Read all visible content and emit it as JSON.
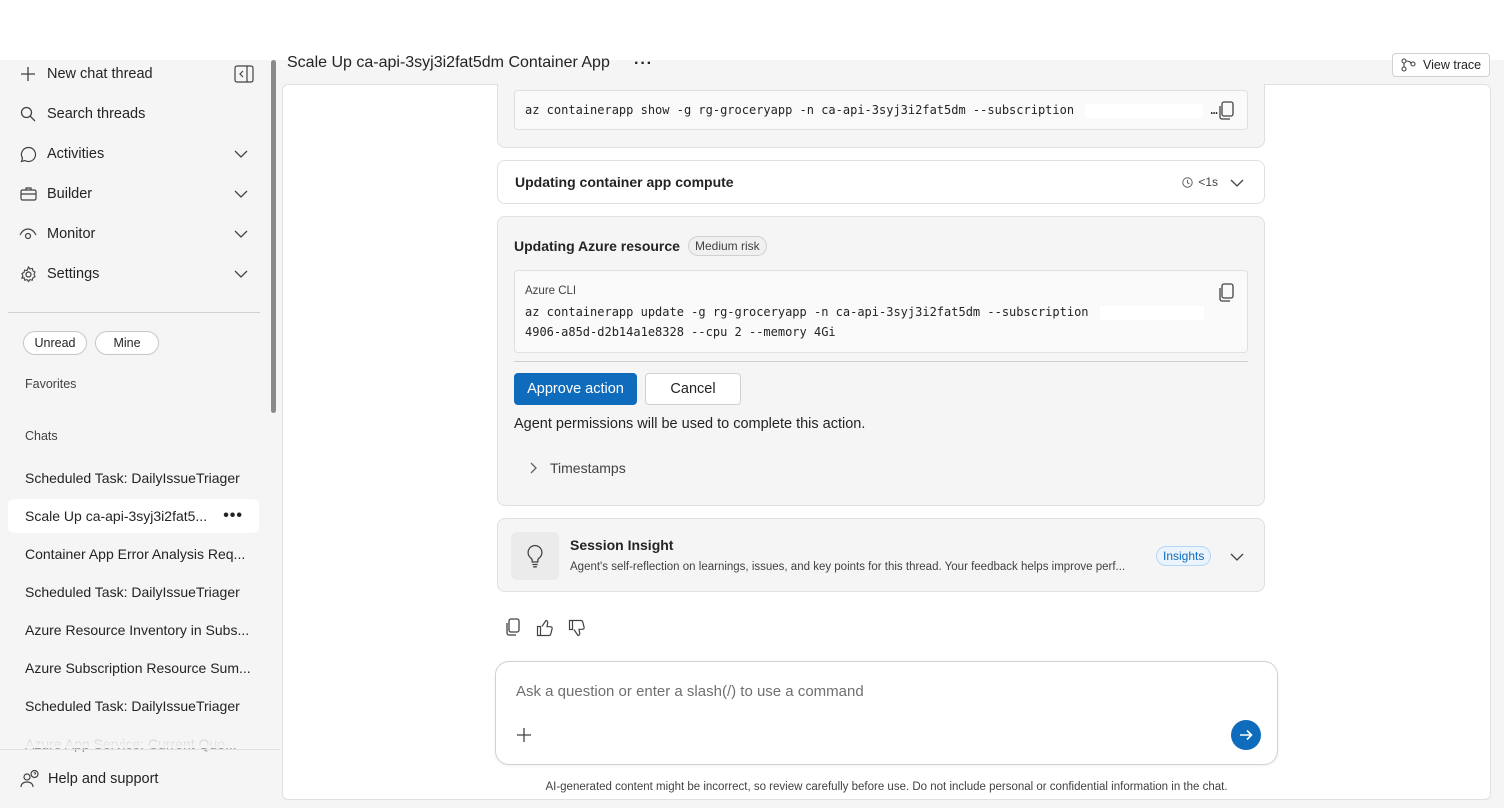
{
  "sidebar": {
    "nav": [
      {
        "label": "New chat thread",
        "icon": "plus-icon"
      },
      {
        "label": "Search threads",
        "icon": "search-icon"
      },
      {
        "label": "Activities",
        "icon": "chat-bubble-icon"
      },
      {
        "label": "Builder",
        "icon": "briefcase-icon"
      },
      {
        "label": "Monitor",
        "icon": "eye-icon"
      },
      {
        "label": "Settings",
        "icon": "gear-icon"
      }
    ],
    "filters": {
      "unread": "Unread",
      "mine": "Mine"
    },
    "favorites_label": "Favorites",
    "chats_label": "Chats",
    "chats": [
      "Scheduled Task: DailyIssueTriager",
      "Scale Up ca-api-3syj3i2fat5...",
      "Container App Error Analysis Req...",
      "Scheduled Task: DailyIssueTriager",
      "Azure Resource Inventory in Subs...",
      "Azure Subscription Resource Sum...",
      "Scheduled Task: DailyIssueTriager",
      "Azure App Service: Current Quo..."
    ],
    "active_chat_index": 1,
    "help": "Help and support"
  },
  "header": {
    "title": "Scale Up ca-api-3syj3i2fat5dm Container App",
    "more": "···",
    "view_trace": "View trace"
  },
  "thread": {
    "first_command": "az containerapp show -g rg-groceryapp -n ca-api-3syj3i2fat5dm --subscription",
    "first_command_tail": "…",
    "step": {
      "title": "Updating container app compute",
      "duration": "<1s"
    },
    "action": {
      "title": "Updating Azure resource",
      "risk": "Medium risk",
      "code_label": "Azure CLI",
      "code_line1": "az containerapp update -g rg-groceryapp -n ca-api-3syj3i2fat5dm --subscription",
      "code_line2": "4906-a85d-d2b14a1e8328 --cpu 2 --memory 4Gi",
      "approve": "Approve action",
      "cancel": "Cancel",
      "note": "Agent permissions will be used to complete this action.",
      "timestamps": "Timestamps"
    },
    "insight": {
      "title": "Session Insight",
      "description": "Agent's self-reflection on learnings, issues, and key points for this thread. Your feedback helps improve perf...",
      "badge": "Insights"
    }
  },
  "composer": {
    "placeholder": "Ask a question or enter a slash(/) to use a command",
    "disclaimer": "AI-generated content might be incorrect, so review carefully before use. Do not include personal or confidential information in the chat."
  },
  "colors": {
    "accent": "#0f6cbd",
    "panel": "#f5f5f5"
  }
}
